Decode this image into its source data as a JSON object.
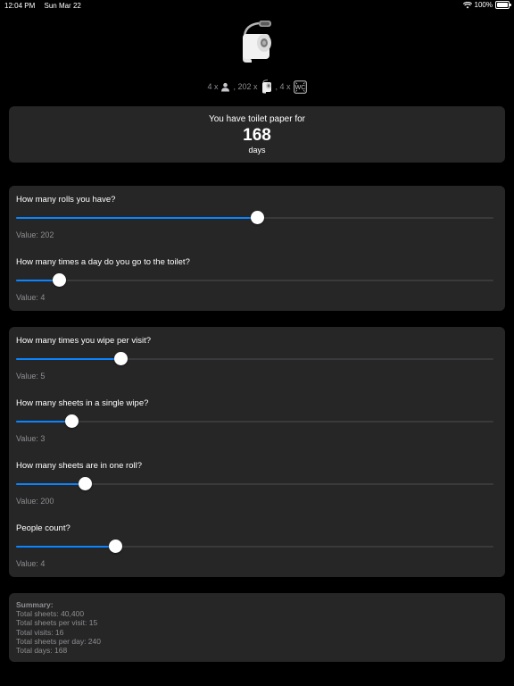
{
  "status_bar": {
    "time": "12:04 PM",
    "date": "Sun Mar 22",
    "battery": "100%"
  },
  "icons": {
    "hero": "toilet-paper-holder-icon",
    "person": "person-icon",
    "roll": "toilet-roll-icon",
    "wc": "wc-sign-icon",
    "wifi": "wifi-icon",
    "battery": "battery-icon"
  },
  "summary_line": {
    "people": "4 x",
    "rolls": ", 202 x",
    "visits": ", 4 x"
  },
  "result": {
    "label": "You have toilet paper for",
    "value": "168",
    "unit": "days"
  },
  "sliders": [
    {
      "question": "How many rolls you have?",
      "value_text": "Value: 202",
      "fill": 0.505
    },
    {
      "question": "How many times a day do you go to the toilet?",
      "value_text": "Value: 4",
      "fill": 0.09
    },
    {
      "question": "How many times you wipe per visit?",
      "value_text": "Value: 5",
      "fill": 0.22
    },
    {
      "question": "How many sheets in a single wipe?",
      "value_text": "Value: 3",
      "fill": 0.116
    },
    {
      "question": "How many sheets are in one roll?",
      "value_text": "Value: 200",
      "fill": 0.144
    },
    {
      "question": "People count?",
      "value_text": "Value: 4",
      "fill": 0.209
    }
  ],
  "summary": {
    "title": "Summary:",
    "lines": [
      "Total sheets: 40,400",
      "Total sheets per visit: 15",
      "Total visits: 16",
      "Total sheets per day: 240",
      "Total days: 168"
    ]
  },
  "colors": {
    "accent": "#0a84ff",
    "card": "#262626",
    "track": "#3a3a3c",
    "secondary_text": "#8e8e93"
  }
}
